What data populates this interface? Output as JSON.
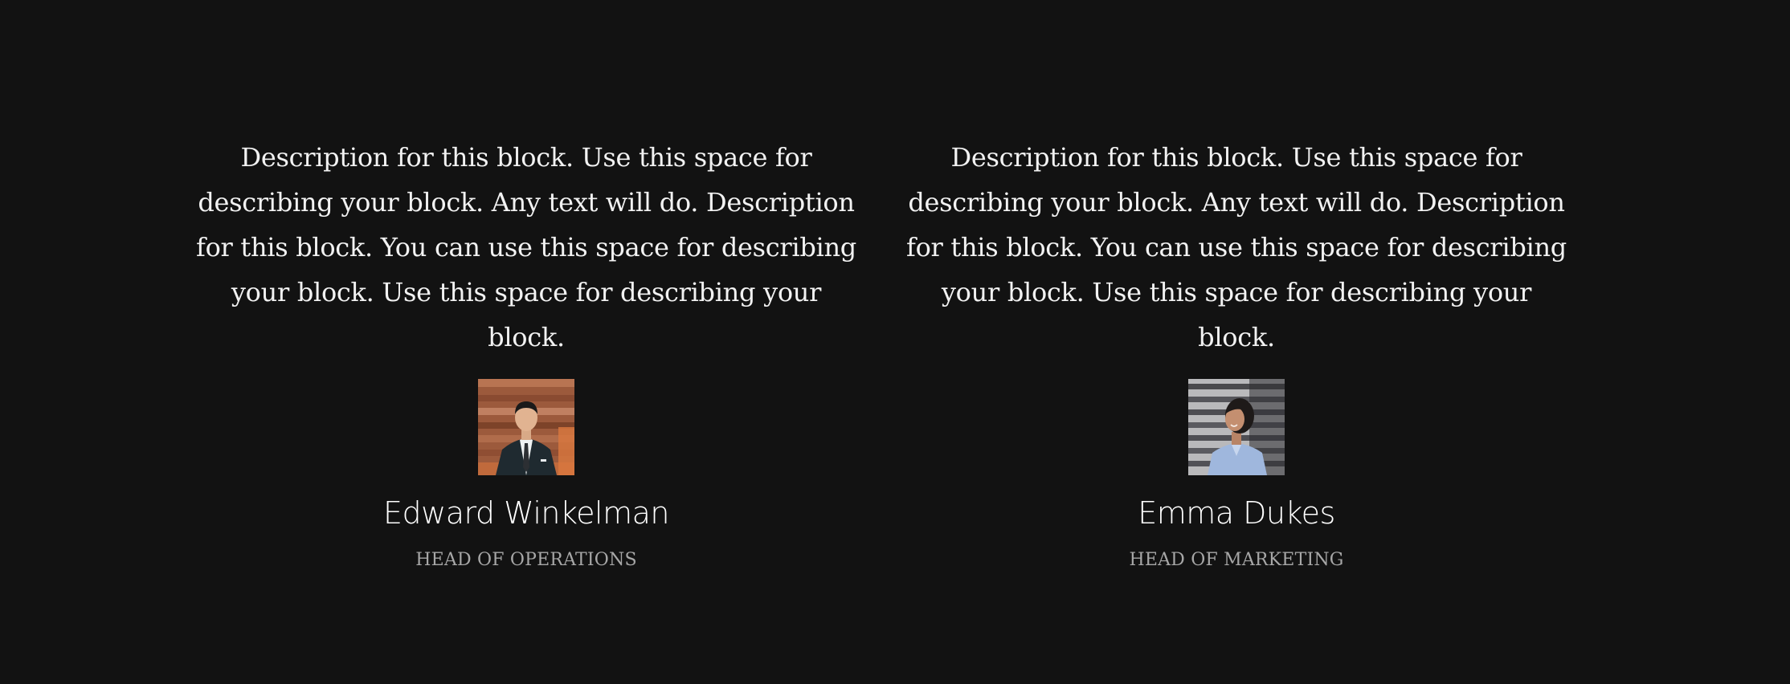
{
  "members": [
    {
      "description": "Description for this block. Use this space for describing your block. Any text will do. Description for this block. You can use this space for describing your block. Use this space for describing your block.",
      "name": "Edward Winkelman",
      "role": "HEAD OF OPERATIONS",
      "photo_icon": "portrait-man-suit-icon"
    },
    {
      "description": "Description for this block. Use this space for describing your block. Any text will do. Description for this block. You can use this space for describing your block. Use this space for describing your block.",
      "name": "Emma Dukes",
      "role": "HEAD OF MARKETING",
      "photo_icon": "portrait-woman-shirt-icon"
    }
  ],
  "colors": {
    "background": "#121212",
    "text": "#ffffff",
    "role_text": "#a7a7a7"
  }
}
